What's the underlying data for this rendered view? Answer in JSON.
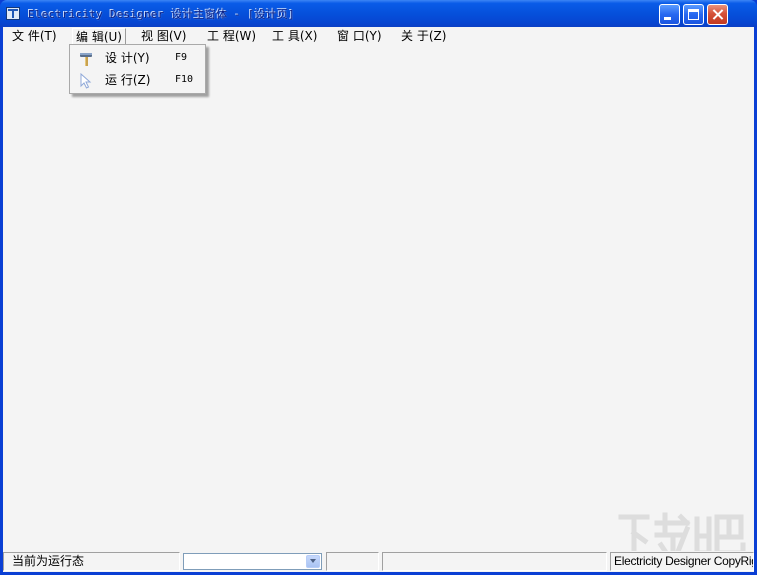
{
  "window": {
    "title": "Electricity Designer 设计主窗体 - [设计页]"
  },
  "menubar": {
    "items": [
      {
        "label": "文 件(T)"
      },
      {
        "label": "编 辑(U)"
      },
      {
        "label": "视 图(V)"
      },
      {
        "label": "工 程(W)"
      },
      {
        "label": "工 具(X)"
      },
      {
        "label": "窗 口(Y)"
      },
      {
        "label": "关 于(Z)"
      }
    ]
  },
  "dropdown": {
    "items": [
      {
        "label": "设  计(Y)",
        "shortcut": "F9",
        "icon": "hammer-icon"
      },
      {
        "label": "运  行(Z)",
        "shortcut": "F10",
        "icon": "pointer-icon"
      }
    ]
  },
  "statusbar": {
    "status_text": "当前为运行态",
    "combo_value": "",
    "copyright": "Electricity Designer CopyRight"
  },
  "colors": {
    "titlebar": "#0550db",
    "client": "#f4f4f4",
    "close_button": "#d5523a"
  }
}
